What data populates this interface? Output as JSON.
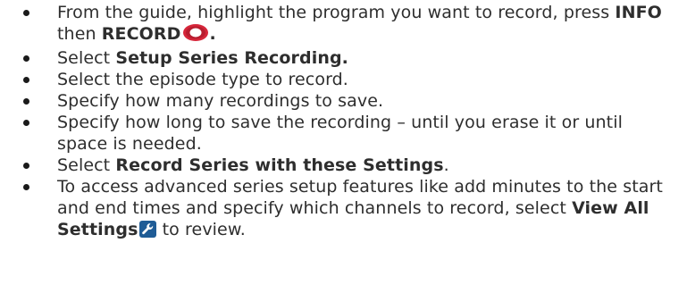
{
  "steps": [
    {
      "parts": [
        "From the guide, highlight the program you want to record, press ",
        "INFO",
        " then ",
        "RECORD",
        "."
      ],
      "icon": "record-icon"
    },
    {
      "parts": [
        "Select ",
        "Setup Series Recording."
      ]
    },
    {
      "parts": [
        "Select the episode type to record."
      ]
    },
    {
      "parts": [
        "Specify how many recordings to save."
      ]
    },
    {
      "parts": [
        "Specify how long to save the recording – until you erase it or until space is needed."
      ]
    },
    {
      "parts": [
        "Select ",
        "Record Series with these Settings",
        "."
      ]
    },
    {
      "parts": [
        "To access advanced series setup features like add minutes to the start and end times and specify which channels to record, select ",
        "View All Settings",
        " to review."
      ],
      "icon": "wrench-icon"
    }
  ],
  "colors": {
    "text": "#2e2e2e",
    "record_red": "#d6263a",
    "settings_blue": "#1f5c96"
  }
}
